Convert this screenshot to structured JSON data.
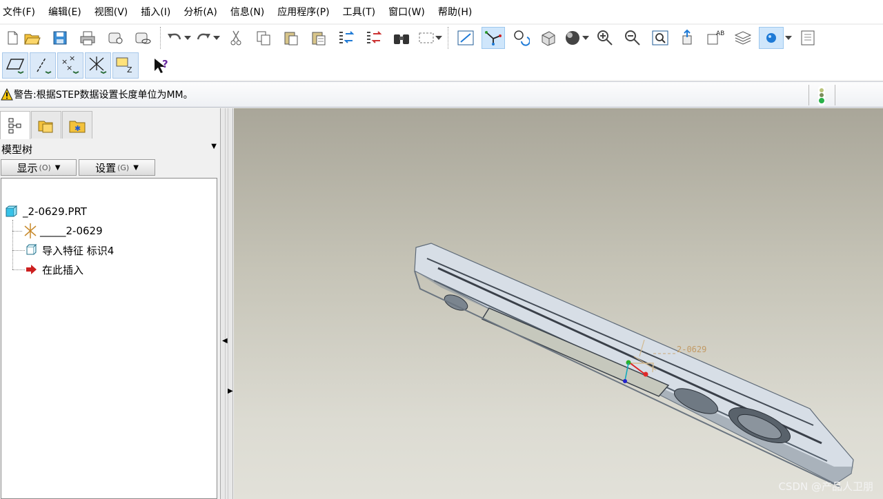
{
  "menu": [
    "文件(F)",
    "编辑(E)",
    "视图(V)",
    "插入(I)",
    "分析(A)",
    "信息(N)",
    "应用程序(P)",
    "工具(T)",
    "窗口(W)",
    "帮助(H)"
  ],
  "status": {
    "message": "警告:根据STEP数据设置长度单位为MM。"
  },
  "panel": {
    "title": "模型树",
    "show_label": "显示",
    "show_key": "(O)",
    "settings_label": "设置",
    "settings_key": "(G)"
  },
  "tree": {
    "root": "_2-0629.PRT",
    "items": [
      "_____2-0629",
      "导入特征 标识4",
      "在此插入"
    ]
  },
  "viewport": {
    "csys_label": "2-0629",
    "watermark": "CSDN @产品人卫朋"
  },
  "colors": {
    "accent": "#1e7ad6",
    "insert_arrow": "#cc1f1f",
    "part_cyan": "#37c2e8"
  }
}
